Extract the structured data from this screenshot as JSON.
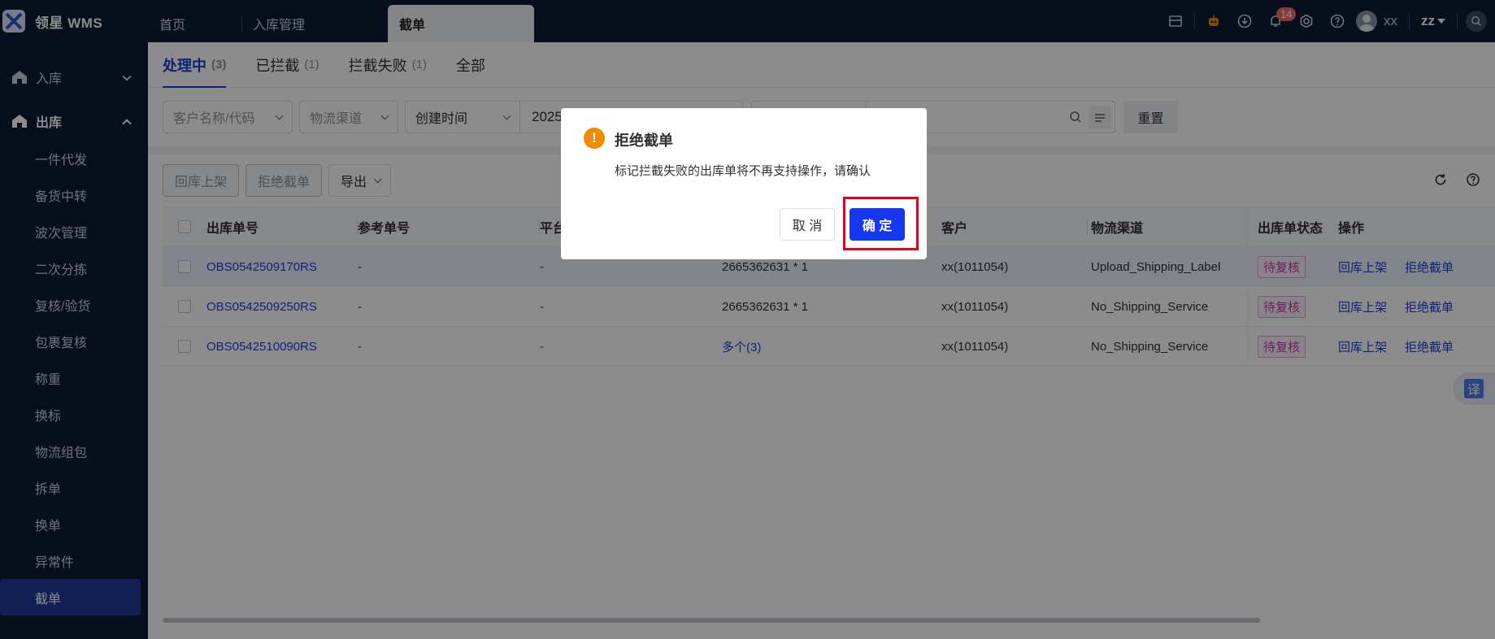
{
  "app": {
    "logo_text": "领星 WMS"
  },
  "nav_tabs": [
    {
      "label": "首页"
    },
    {
      "label": "入库管理"
    },
    {
      "label": "截单"
    }
  ],
  "topbar": {
    "notification_count": "14",
    "user_name": "xx",
    "language": "zz"
  },
  "sidebar": {
    "groups": [
      {
        "label": "入库"
      },
      {
        "label": "出库"
      }
    ],
    "items": [
      {
        "label": "一件代发"
      },
      {
        "label": "备货中转"
      },
      {
        "label": "波次管理"
      },
      {
        "label": "二次分拣"
      },
      {
        "label": "复核/验货"
      },
      {
        "label": "包裹复核"
      },
      {
        "label": "称重"
      },
      {
        "label": "换标"
      },
      {
        "label": "物流组包"
      },
      {
        "label": "拆单"
      },
      {
        "label": "换单"
      },
      {
        "label": "异常件"
      },
      {
        "label": "截单"
      }
    ]
  },
  "status_tabs": [
    {
      "label": "处理中",
      "count": "(3)"
    },
    {
      "label": "已拦截",
      "count": "(1)"
    },
    {
      "label": "拦截失败",
      "count": "(1)"
    },
    {
      "label": "全部",
      "count": ""
    }
  ],
  "filters": {
    "customer_placeholder": "客户名称/代码",
    "channel_placeholder": "物流渠道",
    "time_type": "创建时间",
    "date_value": "2025",
    "reset_label": "重置"
  },
  "actions": {
    "restock": "回库上架",
    "reject": "拒绝截单",
    "export": "导出"
  },
  "table": {
    "headers": [
      "出库单号",
      "参考单号",
      "平台",
      "",
      "客户",
      "物流渠道",
      "出库单状态",
      "操作"
    ],
    "rows": [
      {
        "order_no": "OBS0542509170RS",
        "ref": "-",
        "platform": "-",
        "sku": "2665362631 * 1",
        "customer": "xx(1011054)",
        "channel": "Upload_Shipping_Label",
        "status": "待复核",
        "op1": "回库上架",
        "op2": "拒绝截单"
      },
      {
        "order_no": "OBS0542509250RS",
        "ref": "-",
        "platform": "-",
        "sku": "2665362631 * 1",
        "customer": "xx(1011054)",
        "channel": "No_Shipping_Service",
        "status": "待复核",
        "op1": "回库上架",
        "op2": "拒绝截单"
      },
      {
        "order_no": "OBS0542510090RS",
        "ref": "-",
        "platform": "-",
        "sku": "多个(3)",
        "customer": "xx(1011054)",
        "channel": "No_Shipping_Service",
        "status": "待复核",
        "op1": "回库上架",
        "op2": "拒绝截单"
      }
    ]
  },
  "translate_fab": "译",
  "modal": {
    "icon": "!",
    "title": "拒绝截单",
    "message": "标记拦截失败的出库单将不再支持操作，请确认",
    "cancel_label": "取 消",
    "confirm_label": "确 定"
  },
  "colors": {
    "primary": "#1a3fd6",
    "confirm": "#1537ef",
    "warning": "#f08a00",
    "highlight": "#e0001b",
    "sidebar_bg": "#0d1a33"
  }
}
